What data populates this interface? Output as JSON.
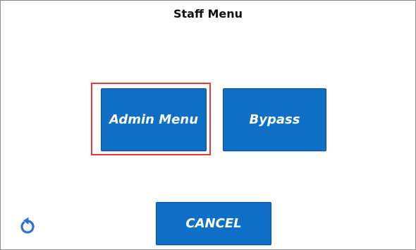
{
  "screen": {
    "title": "Staff Menu"
  },
  "buttons": {
    "admin_menu": "Admin Menu",
    "bypass": "Bypass",
    "cancel": "CANCEL"
  },
  "icons": {
    "refresh": "refresh-icon"
  },
  "colors": {
    "button_blue": "#0f6fc6",
    "highlight_red": "#e53935",
    "refresh_icon": "#2e6fd8"
  }
}
